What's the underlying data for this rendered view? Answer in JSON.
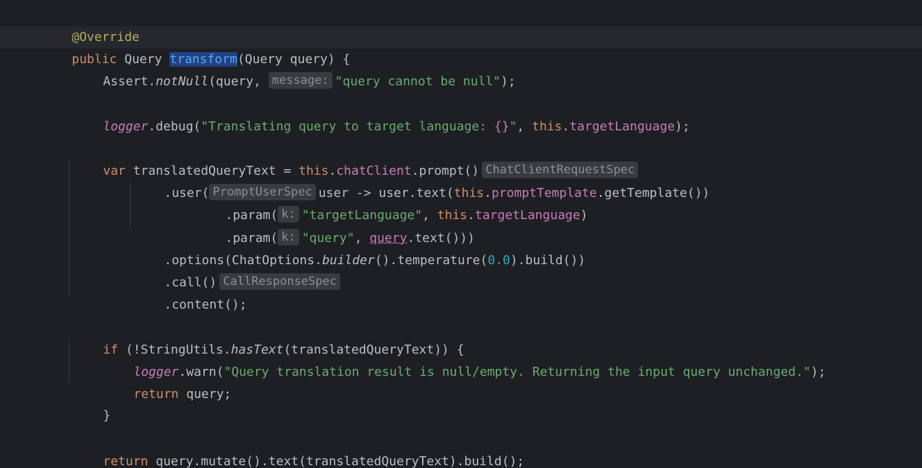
{
  "code": {
    "l1_annotation": "@Override",
    "l2_public": "public",
    "l2_type": "Query",
    "l2_method": "transform",
    "l2_params": "(Query query) {",
    "l3_pre": "Assert.",
    "l3_method": "notNull",
    "l3_args": "(query, ",
    "l3_hint": "message:",
    "l3_str": "\"query cannot be null\"",
    "l3_end": ");",
    "l5_logger": "logger",
    "l5_call": ".debug(",
    "l5_str_a": "\"Translating query to target language: ",
    "l5_braces": "{}",
    "l5_str_b": "\"",
    "l5_comma": ", ",
    "l5_this": "this",
    "l5_dot": ".",
    "l5_field": "targetLanguage",
    "l5_end": ");",
    "l7_var": "var",
    "l7_name": " translatedQueryText = ",
    "l7_this": "this",
    "l7_dot": ".",
    "l7_field": "chatClient",
    "l7_call": ".prompt()",
    "l7_hint": "ChatClientRequestSpec",
    "l8_user": ".user(",
    "l8_hint": "PromptUserSpec",
    "l8_lambda": "user -> user.text(",
    "l8_this": "this",
    "l8_dot": ".",
    "l8_field": "promptTemplate",
    "l8_end": ".getTemplate())",
    "l9_param": ".param(",
    "l9_hint": "k:",
    "l9_str": "\"targetLanguage\"",
    "l9_comma": ", ",
    "l9_this": "this",
    "l9_dot": ".",
    "l9_field": "targetLanguage",
    "l9_end": ")",
    "l10_param": ".param(",
    "l10_hint": "k:",
    "l10_str": "\"query\"",
    "l10_comma": ", ",
    "l10_query": "query",
    "l10_end": ".text()))",
    "l11_options": ".options(ChatOptions.",
    "l11_builder": "builder",
    "l11_temp": "().temperature(",
    "l11_num": "0.0",
    "l11_end": ").build())",
    "l12_call": ".call()",
    "l12_hint": "CallResponseSpec",
    "l13_content": ".content();",
    "l15_if": "if",
    "l15_pre": " (!StringUtils.",
    "l15_hastext": "hasText",
    "l15_end": "(translatedQueryText)) {",
    "l16_logger": "logger",
    "l16_call": ".warn(",
    "l16_str": "\"Query translation result is null/empty. Returning the input query unchanged.\"",
    "l16_end": ");",
    "l17_return": "return",
    "l17_rest": " query;",
    "l18_close": "}",
    "l20_return": "return",
    "l20_rest": " query.mutate().text(translatedQueryText).build();",
    "l21_close": "}"
  },
  "colors": {
    "background": "#1e1f22",
    "keyword": "#cf8e6d",
    "string": "#6aab73",
    "field": "#c77dbb",
    "number": "#2aacb8",
    "annotation": "#b3ae60",
    "method_declaration": "#56a8f5",
    "default_text": "#bcbec4",
    "inlay_hint_bg": "#393b40",
    "inlay_hint_text": "#8c8f96",
    "selection": "#214283"
  }
}
